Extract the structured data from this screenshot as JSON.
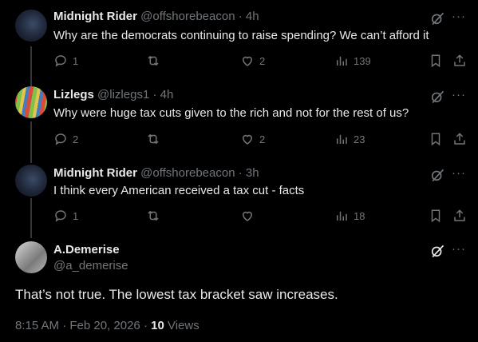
{
  "replies": [
    {
      "name": "Midnight Rider",
      "handle": "@offshorebeacon",
      "time": "4h",
      "text": "Why are the democrats continuing to raise spending? We can’t afford it",
      "reply_count": "1",
      "retweet_count": "",
      "like_count": "2",
      "view_count": "139"
    },
    {
      "name": "Lizlegs",
      "handle": "@lizlegs1",
      "time": "4h",
      "text": "Why were huge tax cuts given to the rich and not for the rest of us?",
      "reply_count": "2",
      "retweet_count": "",
      "like_count": "2",
      "view_count": "23"
    },
    {
      "name": "Midnight Rider",
      "handle": "@offshorebeacon",
      "time": "3h",
      "text": "I think every American received a tax cut - facts",
      "reply_count": "1",
      "retweet_count": "",
      "like_count": "",
      "view_count": "18"
    }
  ],
  "main": {
    "name": "A.Demerise",
    "handle": "@a_demerise",
    "text": "That’s not true. The lowest tax bracket saw increases.",
    "timestamp": "8:15 AM · Feb 20, 2026",
    "sep": "·",
    "views_count": "10",
    "views_label": "Views"
  },
  "separator": "·",
  "more_glyph": "···",
  "colors": {
    "background": "#000000",
    "text": "#e7e9ea",
    "muted": "#71767b",
    "line": "#333639"
  }
}
